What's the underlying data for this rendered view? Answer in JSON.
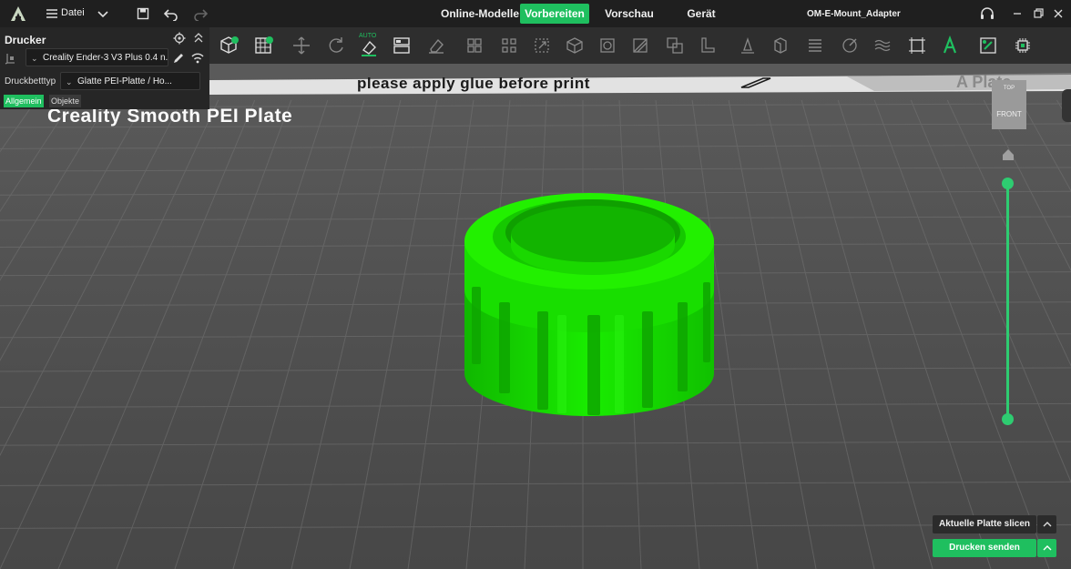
{
  "app": {
    "title": "OM-E-Mount_Adapter",
    "menu_label": "Datei",
    "tabs": [
      {
        "label": "Online-Modelle",
        "active": false
      },
      {
        "label": "Vorbereiten",
        "active": true
      },
      {
        "label": "Vorschau",
        "active": false
      },
      {
        "label": "Gerät",
        "active": false
      }
    ],
    "accent_color": "#1fbf5f"
  },
  "printer_panel": {
    "header": "Drucker",
    "printer_name": "Creality Ender-3 V3 Plus 0.4 n...",
    "bed_type_label": "Druckbetttyp",
    "bed_type_value": "Glatte PEI-Platte / Ho...",
    "tab_general": "Allgemein",
    "tab_objects": "Objekte"
  },
  "toolbar": {
    "auto_label": "AUTO",
    "tools": [
      "add-object",
      "grid",
      "move",
      "rotate",
      "auto-orient",
      "arrange",
      "erase",
      "layout-a",
      "layout-b",
      "scale",
      "box",
      "cylinder",
      "slice",
      "split",
      "support",
      "cut",
      "measure",
      "mesh",
      "seam",
      "paint",
      "fuzzy",
      "bounds",
      "text",
      "assemble",
      "chip"
    ]
  },
  "viewport": {
    "plate_notice": "please apply glue before print",
    "plate_name": "Creality Smooth PEI Plate",
    "plate_watermark": "A Plate",
    "view_cube_top": "TOP",
    "view_cube_front": "FRONT",
    "model_color": "#16e000",
    "slider_color": "#2ecc71"
  },
  "actions": {
    "slice_label": "Aktuelle Platte slicen",
    "send_label": "Drucken senden"
  }
}
